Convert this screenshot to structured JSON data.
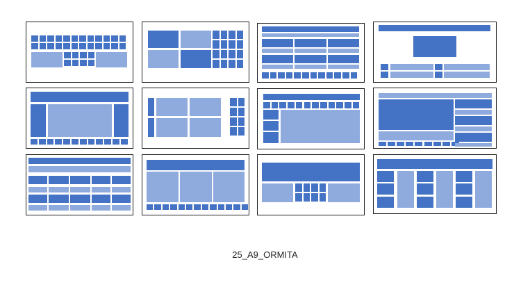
{
  "caption": "25_A9_ORMITA",
  "colors": {
    "dark": "#4472c4",
    "light": "#8faadc",
    "border": "#1a1a1a"
  },
  "thumbnail_names": [
    "grid-top-split-bottom-layout",
    "two-by-two-panels-with-grid-layout",
    "header-rows-with-bottom-strip-layout",
    "centered-block-with-bottom-bars-layout",
    "sidebars-with-center-panel-layout",
    "panels-with-side-grid-layout",
    "grid-header-with-left-column-layout",
    "main-panel-with-right-stack-layout",
    "banded-table-layout",
    "three-columns-with-bottom-strip-layout",
    "banner-with-small-grid-layout",
    "alternating-columns-layout"
  ]
}
